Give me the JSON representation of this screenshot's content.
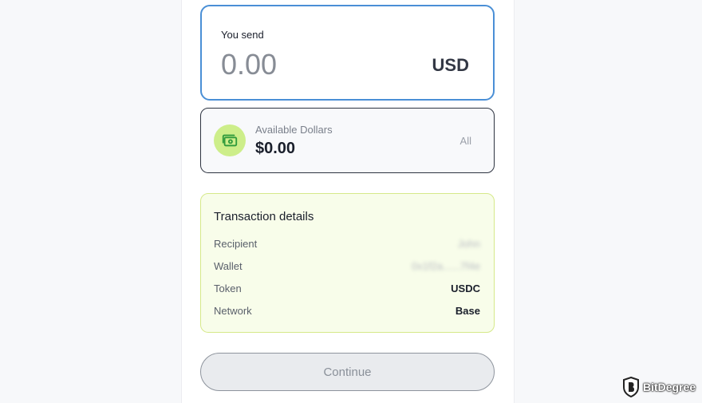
{
  "send": {
    "label": "You send",
    "amount_placeholder": "0.00",
    "currency": "USD"
  },
  "balance": {
    "icon": "wallet-cash-icon",
    "label": "Available Dollars",
    "value": "$0.00",
    "all_label": "All"
  },
  "details": {
    "title": "Transaction details",
    "rows": [
      {
        "key": "Recipient",
        "value": "John"
      },
      {
        "key": "Wallet",
        "value": "0x1f2a......7f4e"
      },
      {
        "key": "Token",
        "value": "USDC"
      },
      {
        "key": "Network",
        "value": "Base"
      }
    ]
  },
  "actions": {
    "continue_label": "Continue"
  },
  "watermark": {
    "text": "BitDegree"
  },
  "colors": {
    "accent_border": "#4a8fd6",
    "wallet_icon_bg": "#cdee8a",
    "wallet_icon_fg": "#2f9a3c",
    "details_bg": "#f8fdea"
  }
}
